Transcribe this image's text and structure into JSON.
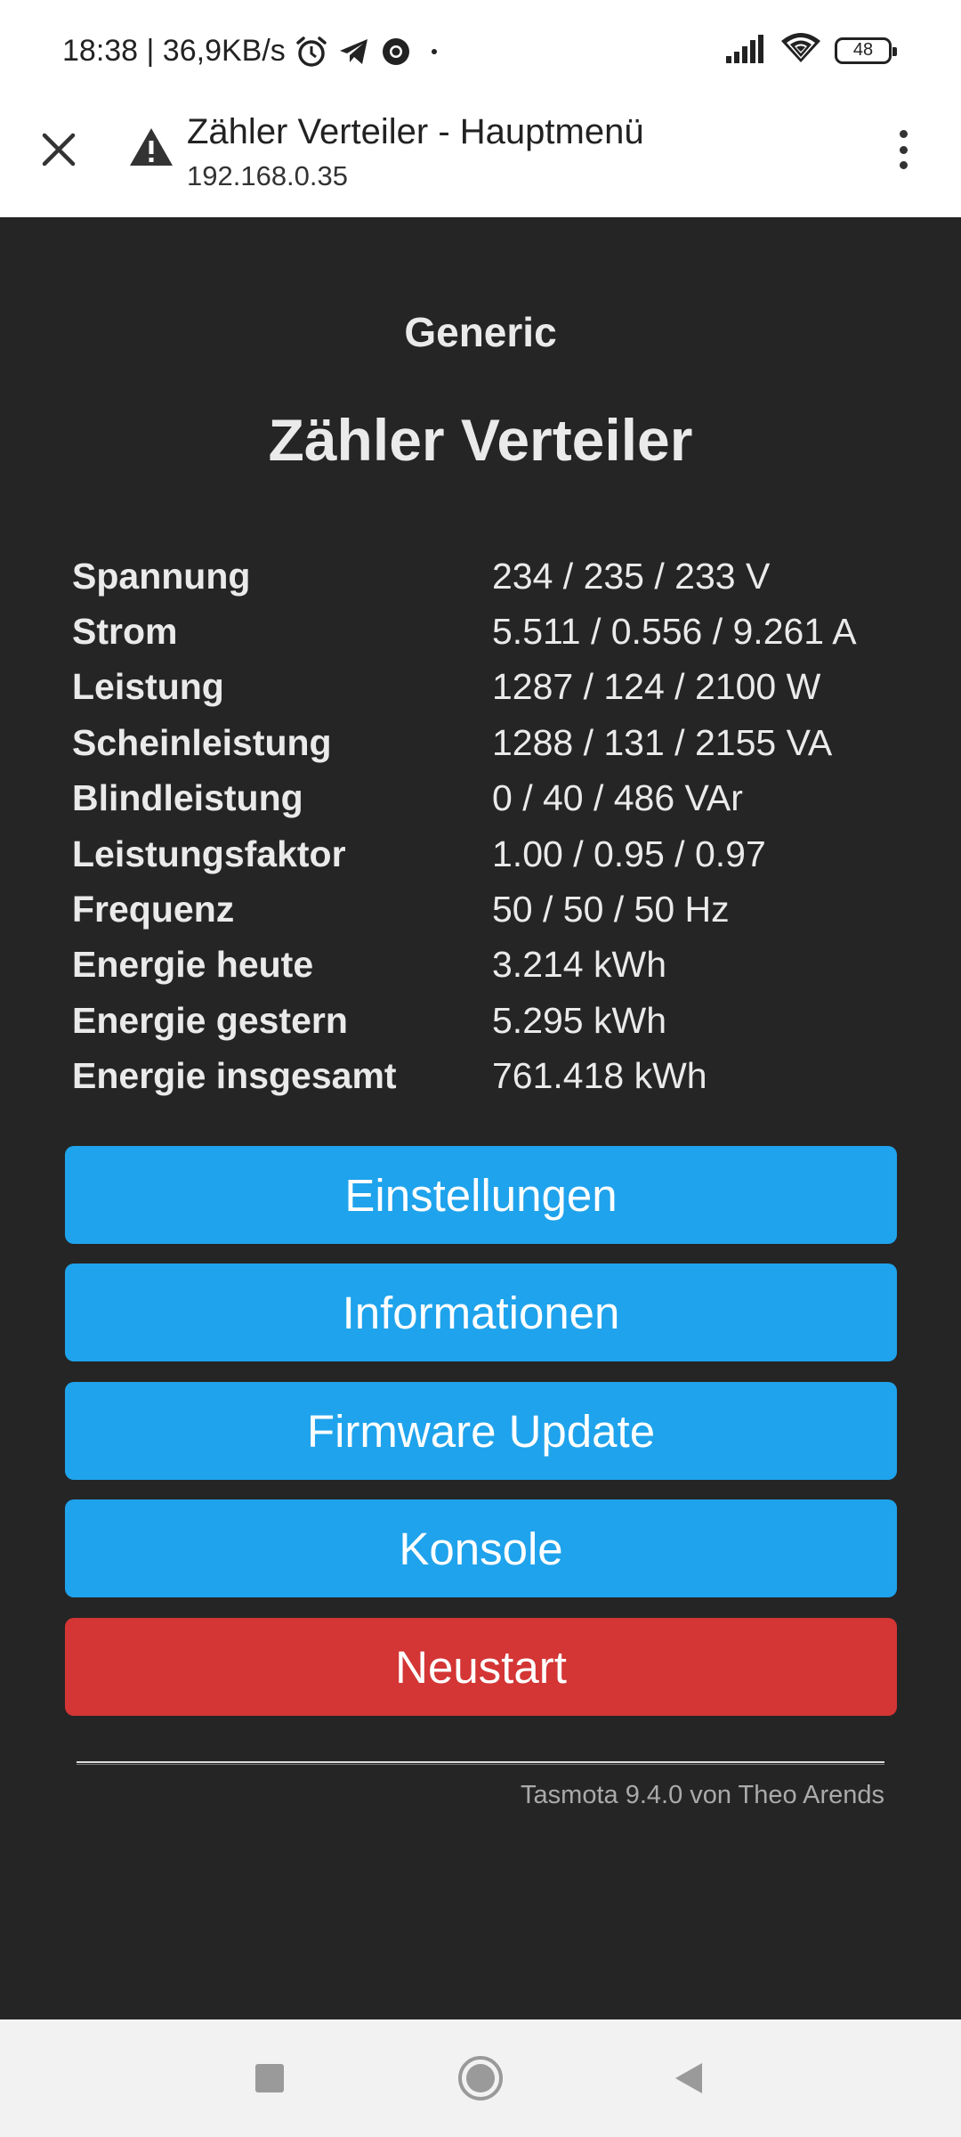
{
  "status_bar": {
    "time_speed": "18:38 | 36,9KB/s",
    "battery": "48",
    "icons": [
      "alarm-icon",
      "telegram-icon",
      "chrome-icon",
      "dot-icon",
      "signal-icon",
      "wifi-icon",
      "battery-icon"
    ]
  },
  "browser": {
    "title": "Zähler Verteiler - Hauptmenü",
    "url": "192.168.0.35",
    "icons": [
      "close-icon",
      "warning-icon",
      "more-vert-icon"
    ]
  },
  "page": {
    "module": "Generic",
    "device": "Zähler Verteiler",
    "sensors": [
      {
        "label": "Spannung",
        "value": "234 / 235 / 233 V"
      },
      {
        "label": "Strom",
        "value": "5.511 / 0.556 / 9.261 A"
      },
      {
        "label": "Leistung",
        "value": "1287 / 124 / 2100 W"
      },
      {
        "label": "Scheinleistung",
        "value": "1288 / 131 / 2155 VA"
      },
      {
        "label": "Blindleistung",
        "value": "0 / 40 / 486 VAr"
      },
      {
        "label": "Leistungsfaktor",
        "value": "1.00 / 0.95 / 0.97"
      },
      {
        "label": "Frequenz",
        "value": "50 / 50 / 50 Hz"
      },
      {
        "label": "Energie heute",
        "value": "3.214 kWh"
      },
      {
        "label": "Energie gestern",
        "value": "5.295 kWh"
      },
      {
        "label": "Energie insgesamt",
        "value": "761.418 kWh"
      }
    ],
    "buttons": {
      "settings": "Einstellungen",
      "information": "Informationen",
      "firmware_update": "Firmware Update",
      "console": "Konsole",
      "restart": "Neustart"
    },
    "footer": "Tasmota 9.4.0 von Theo Arends"
  },
  "colors": {
    "background": "#252525",
    "button_blue": "#1fa3ec",
    "button_red": "#d43535",
    "text": "#eaeaea"
  },
  "nav_bar": {
    "icons": [
      "recents-square-icon",
      "home-circle-icon",
      "back-triangle-icon"
    ]
  }
}
